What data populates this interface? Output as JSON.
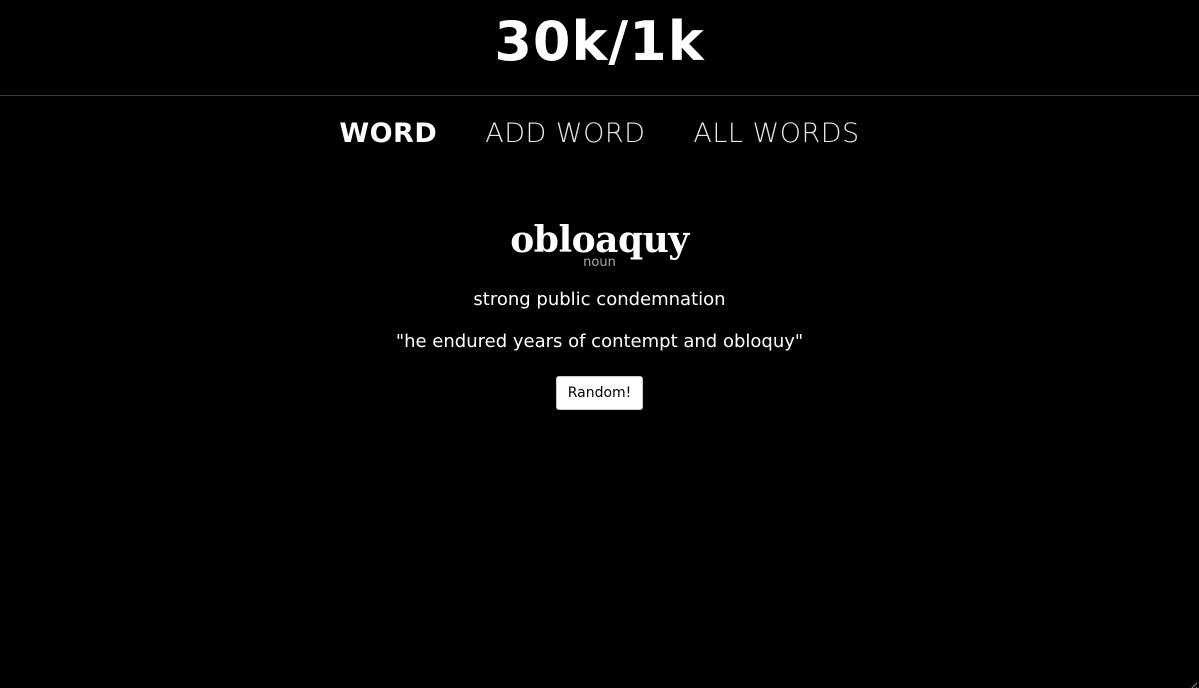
{
  "header": {
    "title": "30k/1k"
  },
  "nav": {
    "items": [
      {
        "label": "WORD",
        "active": true
      },
      {
        "label": "ADD WORD",
        "active": false
      },
      {
        "label": "ALL WORDS",
        "active": false
      }
    ]
  },
  "word": {
    "term": "obloaquy",
    "part_of_speech": "noun",
    "definition": "strong public condemnation",
    "example": "\"he endured years of contempt and obloquy\""
  },
  "actions": {
    "random_label": "Random!"
  },
  "colors": {
    "background": "#000000",
    "text": "#ffffff",
    "muted": "#a9a9a9",
    "divider": "#3a3a3a",
    "button_bg": "#ffffff"
  },
  "icons": {
    "resize": "resize-grip-icon"
  }
}
